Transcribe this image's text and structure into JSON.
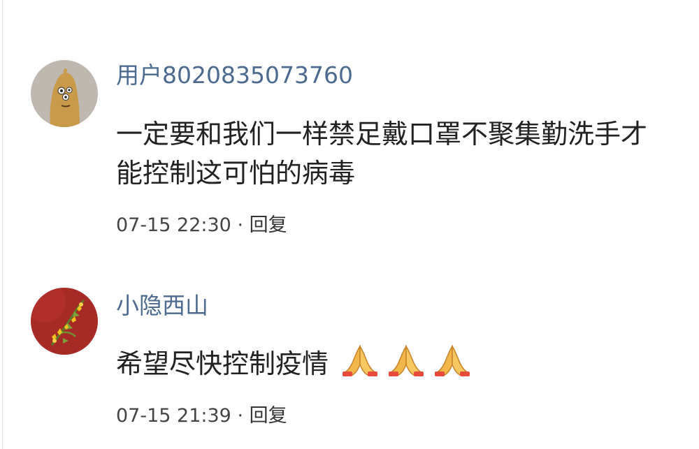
{
  "comments": [
    {
      "username": "用户8020835073760",
      "text": "一定要和我们一样禁足戴口罩不聚集勤洗手才能控制这可怕的病毒",
      "timestamp": "07-15 22:30",
      "separator": " · ",
      "reply_label": "回复",
      "avatar_icon": "cartoon-character-avatar",
      "avatar_bg": "#bfb8b0"
    },
    {
      "username": "小隐西山",
      "text": "希望尽快控制疫情",
      "emoji": [
        "🙏",
        "🙏",
        "🙏"
      ],
      "emoji_icon": "praying-hands-icon",
      "timestamp": "07-15 21:39",
      "separator": " · ",
      "reply_label": "回复",
      "avatar_icon": "flower-photo-avatar",
      "avatar_bg": "#a62a26"
    }
  ],
  "colors": {
    "username": "#4d6a8f",
    "body_text": "#222222",
    "meta_text": "#444444"
  }
}
